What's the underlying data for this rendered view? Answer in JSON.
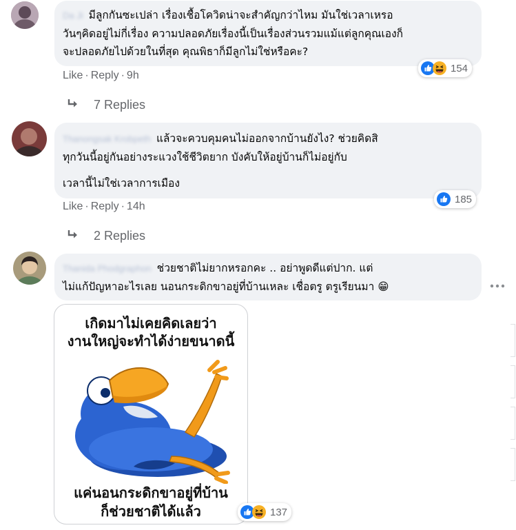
{
  "comments": [
    {
      "author": "Da Ji",
      "text_lines": [
        "มีลูกกันซะเปล่า เรื่องเชื้อโควิดน่าจะสำคัญกว่าไหม มันใช่เวลาเหรอ",
        "วันๆคิดอยู่ไม่กี่เรื่อง ความปลอดภัยเรื่องนี้เป็นเรื่องส่วนรวมแม้แต่ลูกคุณเองก็",
        "จะปลอดภัยไปด้วยในที่สุด คุณพิธาก็มีลูกไม่ใช่หรือคะ?"
      ],
      "actions": {
        "like": "Like",
        "reply": "Reply",
        "time": "9h"
      },
      "reactions": {
        "icons": [
          "like-icon",
          "haha-icon"
        ],
        "count": "154"
      },
      "replies": "7 Replies"
    },
    {
      "author": "Thanongsak Krobpeth",
      "text_lines": [
        "แล้วจะควบคุมคนไม่ออกจากบ้านยังไง? ช่วยคิดสิ",
        "ทุกวันนี้อยู่กันอย่างระแวงใช้ชีวิตยาก บังคับให้อยู่บ้านก็ไม่อยู่กับ",
        "เวลานี้ไม่ใช่เวลาการเมือง"
      ],
      "actions": {
        "like": "Like",
        "reply": "Reply",
        "time": "14h"
      },
      "reactions": {
        "icons": [
          "like-icon"
        ],
        "count": "185"
      },
      "replies": "2 Replies"
    },
    {
      "author": "Thanida Phodgraphon",
      "text_lines": [
        "ช่วยชาติไม่ยากหรอกคะ .. อย่าพูดดีแต่ปาก. แต่",
        "ไม่แก้ปัญหาอะไรเลย นอนกระดิกขาอยู่ที่บ้านเหละ เชื่อตรู ตรูเรียนมา"
      ],
      "emoji": "😁",
      "meme": {
        "top_lines": [
          "เกิดมาไม่เคยคิดเลยว่า",
          "งานใหญ่จะทำได้ง่ายขนาดนี้"
        ],
        "bottom_lines": [
          "แค่นอนกระดิกขาอยู่ที่บ้าน",
          "ก็ช่วยชาติได้แล้ว"
        ],
        "image": "lying-cartoon-bird"
      },
      "reactions": {
        "icons": [
          "like-icon",
          "haha-icon"
        ],
        "count": "137"
      }
    }
  ],
  "colors": {
    "like": "#1877f2",
    "haha": "#f7b125",
    "bubble": "#f0f2f5",
    "meta": "#65676b"
  }
}
